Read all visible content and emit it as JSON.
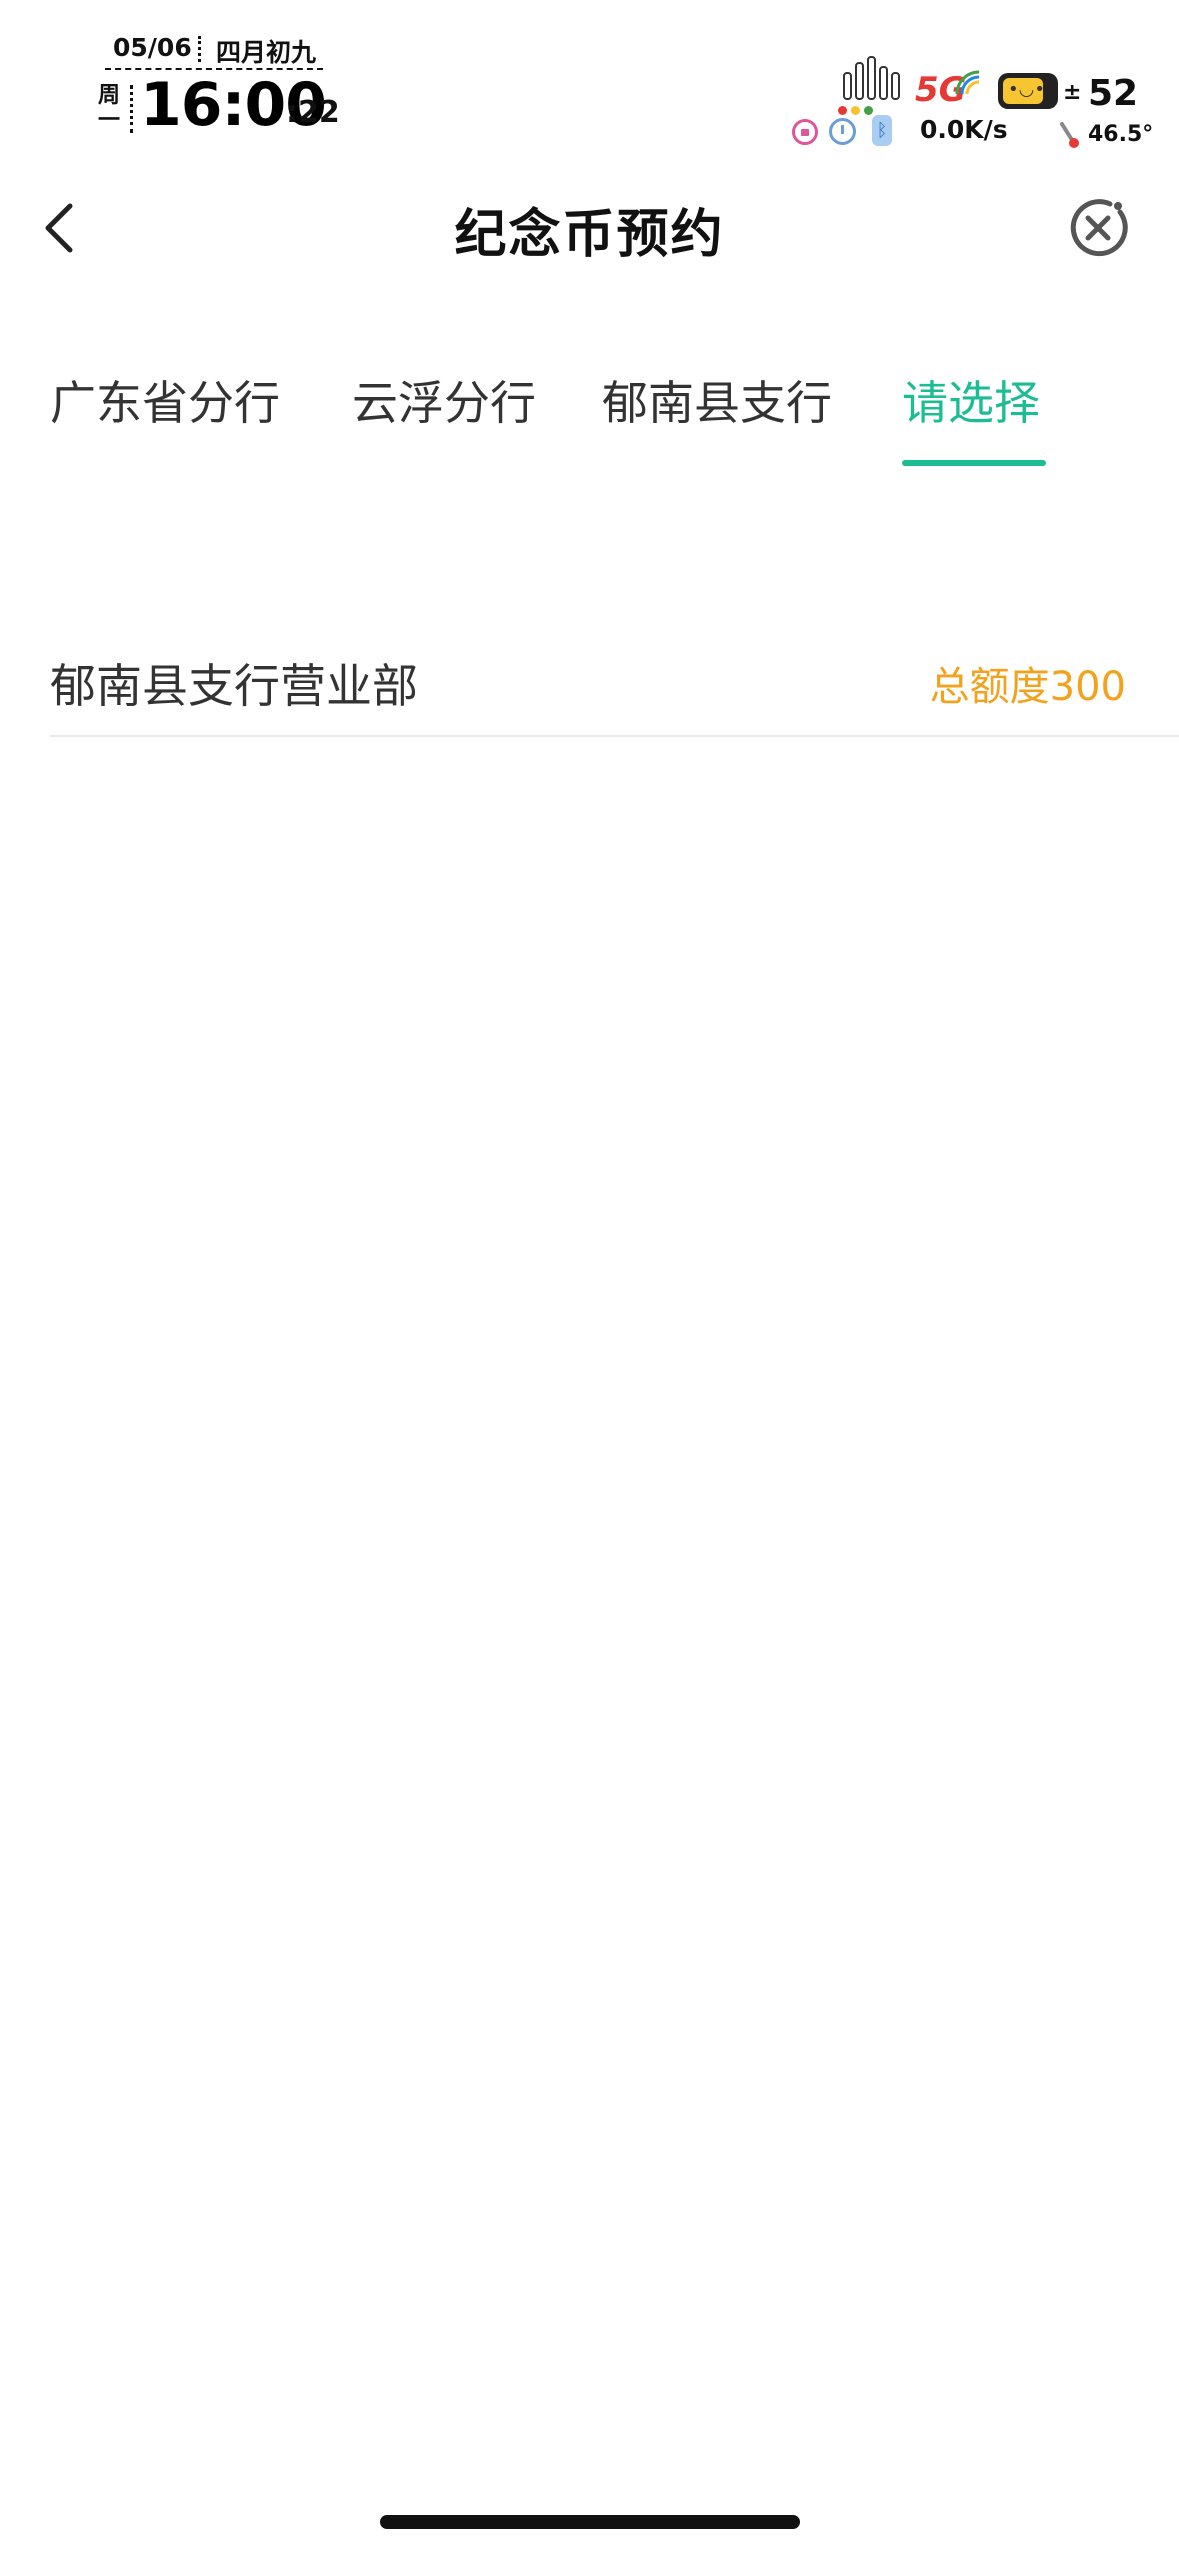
{
  "status_bar": {
    "date": "05/06",
    "lunar_date": "四月初九",
    "weekday": "周一",
    "time": "16:00",
    "seconds": ":22",
    "network_type": "5G",
    "network_speed": "0.0K/s",
    "battery_level": "52",
    "battery_temp": "46.5°",
    "icons": [
      "lock-icon",
      "alarm-icon",
      "bluetooth-icon",
      "signal-bars-icon",
      "battery-icon",
      "thermometer-icon"
    ]
  },
  "nav": {
    "title": "纪念币预约"
  },
  "tabs": [
    {
      "label": "广东省分行",
      "active": false
    },
    {
      "label": "云浮分行",
      "active": false
    },
    {
      "label": "郁南县支行",
      "active": false
    },
    {
      "label": "请选择",
      "active": true
    }
  ],
  "branches": [
    {
      "name": "郁南县支行营业部",
      "quota": "总额度300"
    }
  ],
  "colors": {
    "accent": "#1dbd94",
    "quota": "#f3a21d",
    "text": "#333333"
  }
}
